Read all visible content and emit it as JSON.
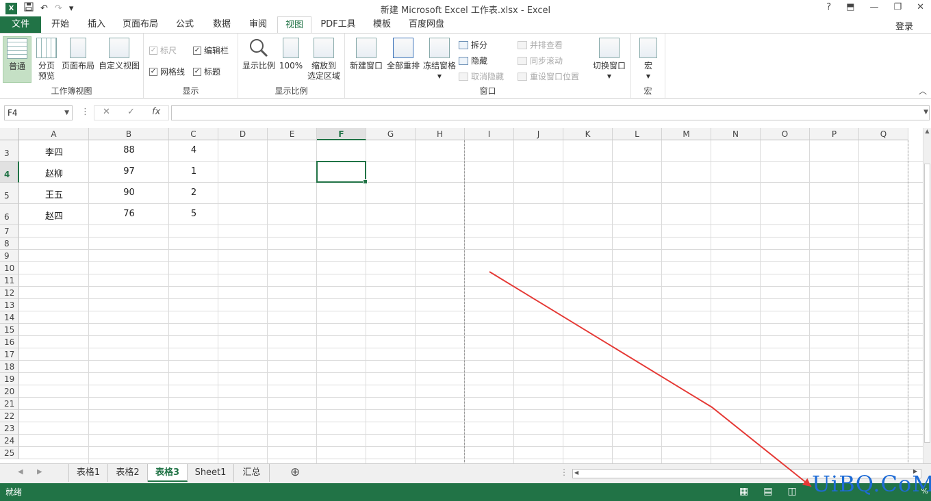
{
  "app": {
    "title": "新建 Microsoft Excel 工作表.xlsx - Excel",
    "logo": "X",
    "login": "登录"
  },
  "qat": {
    "save_icon": "save-icon",
    "undo": "↶",
    "redo": "↷",
    "customize": "▾"
  },
  "window_controls": {
    "help": "?",
    "restore_ribbon": "⬒",
    "minimize": "—",
    "maximize": "❐",
    "close": "✕"
  },
  "tabs": [
    "文件",
    "开始",
    "插入",
    "页面布局",
    "公式",
    "数据",
    "审阅",
    "视图",
    "PDF工具",
    "模板",
    "百度网盘"
  ],
  "ribbon": {
    "workbook_views": {
      "label": "工作簿视图",
      "normal": "普通",
      "page_break_1": "分页",
      "page_break_2": "预览",
      "page_layout": "页面布局",
      "custom_views": "自定义视图"
    },
    "show": {
      "label": "显示",
      "ruler": "标尺",
      "formula_bar": "编辑栏",
      "gridlines": "网格线",
      "headings": "标题"
    },
    "zoom": {
      "label": "显示比例",
      "zoom": "显示比例",
      "hundred": "100%",
      "zoom_sel_1": "缩放到",
      "zoom_sel_2": "选定区域"
    },
    "window": {
      "label": "窗口",
      "new_window": "新建窗口",
      "arrange_all": "全部重排",
      "freeze_panes": "冻结窗格",
      "split": "拆分",
      "hide": "隐藏",
      "unhide": "取消隐藏",
      "side_by_side": "并排查看",
      "sync_scroll": "同步滚动",
      "reset_pos": "重设窗口位置",
      "switch_windows": "切换窗口"
    },
    "macros": {
      "label": "宏",
      "macros": "宏"
    }
  },
  "formula_bar": {
    "name_box": "F4",
    "cancel": "✕",
    "enter": "✓",
    "fx": "fx",
    "value": ""
  },
  "columns": [
    "A",
    "B",
    "C",
    "D",
    "E",
    "F",
    "G",
    "H",
    "I",
    "J",
    "K",
    "L",
    "M",
    "N",
    "O",
    "P",
    "Q"
  ],
  "selected_column": "F",
  "rows": [
    "3",
    "4",
    "5",
    "6",
    "7",
    "8",
    "9",
    "10",
    "11",
    "12",
    "13",
    "14",
    "15",
    "16",
    "17",
    "18",
    "19",
    "20",
    "21",
    "22",
    "23",
    "24",
    "25"
  ],
  "selected_row": "4",
  "data_rows": [
    {
      "a": "李四",
      "b": "88",
      "c": "4"
    },
    {
      "a": "赵柳",
      "b": "97",
      "c": "1"
    },
    {
      "a": "王五",
      "b": "90",
      "c": "2"
    },
    {
      "a": "赵四",
      "b": "76",
      "c": "5"
    }
  ],
  "sheet_tabs": [
    "表格1",
    "表格2",
    "表格3",
    "Sheet1",
    "汇总"
  ],
  "active_sheet": "表格3",
  "add_sheet": "⊕",
  "status": {
    "ready": "就绪",
    "zoom_fragment": "%"
  },
  "watermark": "UiBQ.CoM",
  "colors": {
    "accent": "#217346",
    "arrow": "#e53935"
  }
}
